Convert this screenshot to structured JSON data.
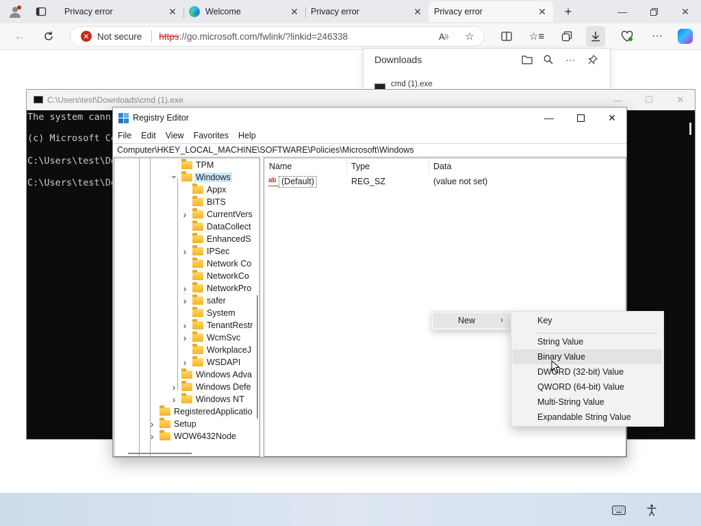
{
  "browser": {
    "tabs": [
      {
        "title": "Privacy error",
        "active": false
      },
      {
        "title": "Welcome",
        "active": false
      },
      {
        "title": "Privacy error",
        "active": false
      },
      {
        "title": "Privacy error",
        "active": true
      }
    ],
    "security_text": "Not secure",
    "url_scheme": "https",
    "url_rest": "://go.microsoft.com/fwlink/?linkid=246338",
    "colors": {
      "insecure": "#c42b1c",
      "tab_bar": "#e8eaed"
    }
  },
  "downloads": {
    "title": "Downloads",
    "items": [
      {
        "name": "cmd (1).exe"
      }
    ]
  },
  "cmd": {
    "title": "C:\\Users\\test\\Downloads\\cmd (1).exe",
    "lines": [
      "The system cann",
      "(c) Microsoft Co",
      "C:\\Users\\test\\Do",
      "C:\\Users\\test\\Do"
    ]
  },
  "regedit": {
    "title": "Registry Editor",
    "menu": [
      "File",
      "Edit",
      "View",
      "Favorites",
      "Help"
    ],
    "address": "Computer\\HKEY_LOCAL_MACHINE\\SOFTWARE\\Policies\\Microsoft\\Windows",
    "tree": [
      {
        "label": "TPM",
        "expandable": false,
        "expanded": false,
        "selected": false,
        "level": 2
      },
      {
        "label": "Windows",
        "expandable": true,
        "expanded": true,
        "selected": true,
        "level": 2
      },
      {
        "label": "Appx",
        "expandable": false,
        "expanded": false,
        "selected": false,
        "level": 3
      },
      {
        "label": "BITS",
        "expandable": false,
        "expanded": false,
        "selected": false,
        "level": 3
      },
      {
        "label": "CurrentVers",
        "expandable": true,
        "expanded": false,
        "selected": false,
        "level": 3
      },
      {
        "label": "DataCollect",
        "expandable": false,
        "expanded": false,
        "selected": false,
        "level": 3
      },
      {
        "label": "EnhancedS",
        "expandable": false,
        "expanded": false,
        "selected": false,
        "level": 3
      },
      {
        "label": "IPSec",
        "expandable": true,
        "expanded": false,
        "selected": false,
        "level": 3
      },
      {
        "label": "Network Co",
        "expandable": false,
        "expanded": false,
        "selected": false,
        "level": 3
      },
      {
        "label": "NetworkCo",
        "expandable": false,
        "expanded": false,
        "selected": false,
        "level": 3
      },
      {
        "label": "NetworkPro",
        "expandable": true,
        "expanded": false,
        "selected": false,
        "level": 3
      },
      {
        "label": "safer",
        "expandable": true,
        "expanded": false,
        "selected": false,
        "level": 3
      },
      {
        "label": "System",
        "expandable": false,
        "expanded": false,
        "selected": false,
        "level": 3
      },
      {
        "label": "TenantRestr",
        "expandable": true,
        "expanded": false,
        "selected": false,
        "level": 3
      },
      {
        "label": "WcmSvc",
        "expandable": true,
        "expanded": false,
        "selected": false,
        "level": 3
      },
      {
        "label": "WorkplaceJ",
        "expandable": false,
        "expanded": false,
        "selected": false,
        "level": 3
      },
      {
        "label": "WSDAPI",
        "expandable": true,
        "expanded": false,
        "selected": false,
        "level": 3
      },
      {
        "label": "Windows Adva",
        "expandable": false,
        "expanded": false,
        "selected": false,
        "level": 2
      },
      {
        "label": "Windows Defe",
        "expandable": true,
        "expanded": false,
        "selected": false,
        "level": 2
      },
      {
        "label": "Windows NT",
        "expandable": true,
        "expanded": false,
        "selected": false,
        "level": 2
      },
      {
        "label": "RegisteredApplicatio",
        "expandable": false,
        "expanded": false,
        "selected": false,
        "level": 1
      },
      {
        "label": "Setup",
        "expandable": true,
        "expanded": false,
        "selected": false,
        "level": 1
      },
      {
        "label": "WOW6432Node",
        "expandable": true,
        "expanded": false,
        "selected": false,
        "level": 1
      }
    ],
    "columns": [
      "Name",
      "Type",
      "Data"
    ],
    "values": [
      {
        "name": "(Default)",
        "type": "REG_SZ",
        "data": "(value not set)",
        "icon": "ab-string-icon"
      }
    ]
  },
  "context_menu": {
    "new_label": "New",
    "submenu": [
      {
        "label": "Key",
        "hovered": false
      },
      {
        "label": "String Value",
        "hovered": false
      },
      {
        "label": "Binary Value",
        "hovered": true
      },
      {
        "label": "DWORD (32-bit) Value",
        "hovered": false
      },
      {
        "label": "QWORD (64-bit) Value",
        "hovered": false
      },
      {
        "label": "Multi-String Value",
        "hovered": false
      },
      {
        "label": "Expandable String Value",
        "hovered": false
      }
    ]
  },
  "taskbar": {
    "tray_icons": [
      "keyboard-icon",
      "accessibility-icon"
    ]
  }
}
